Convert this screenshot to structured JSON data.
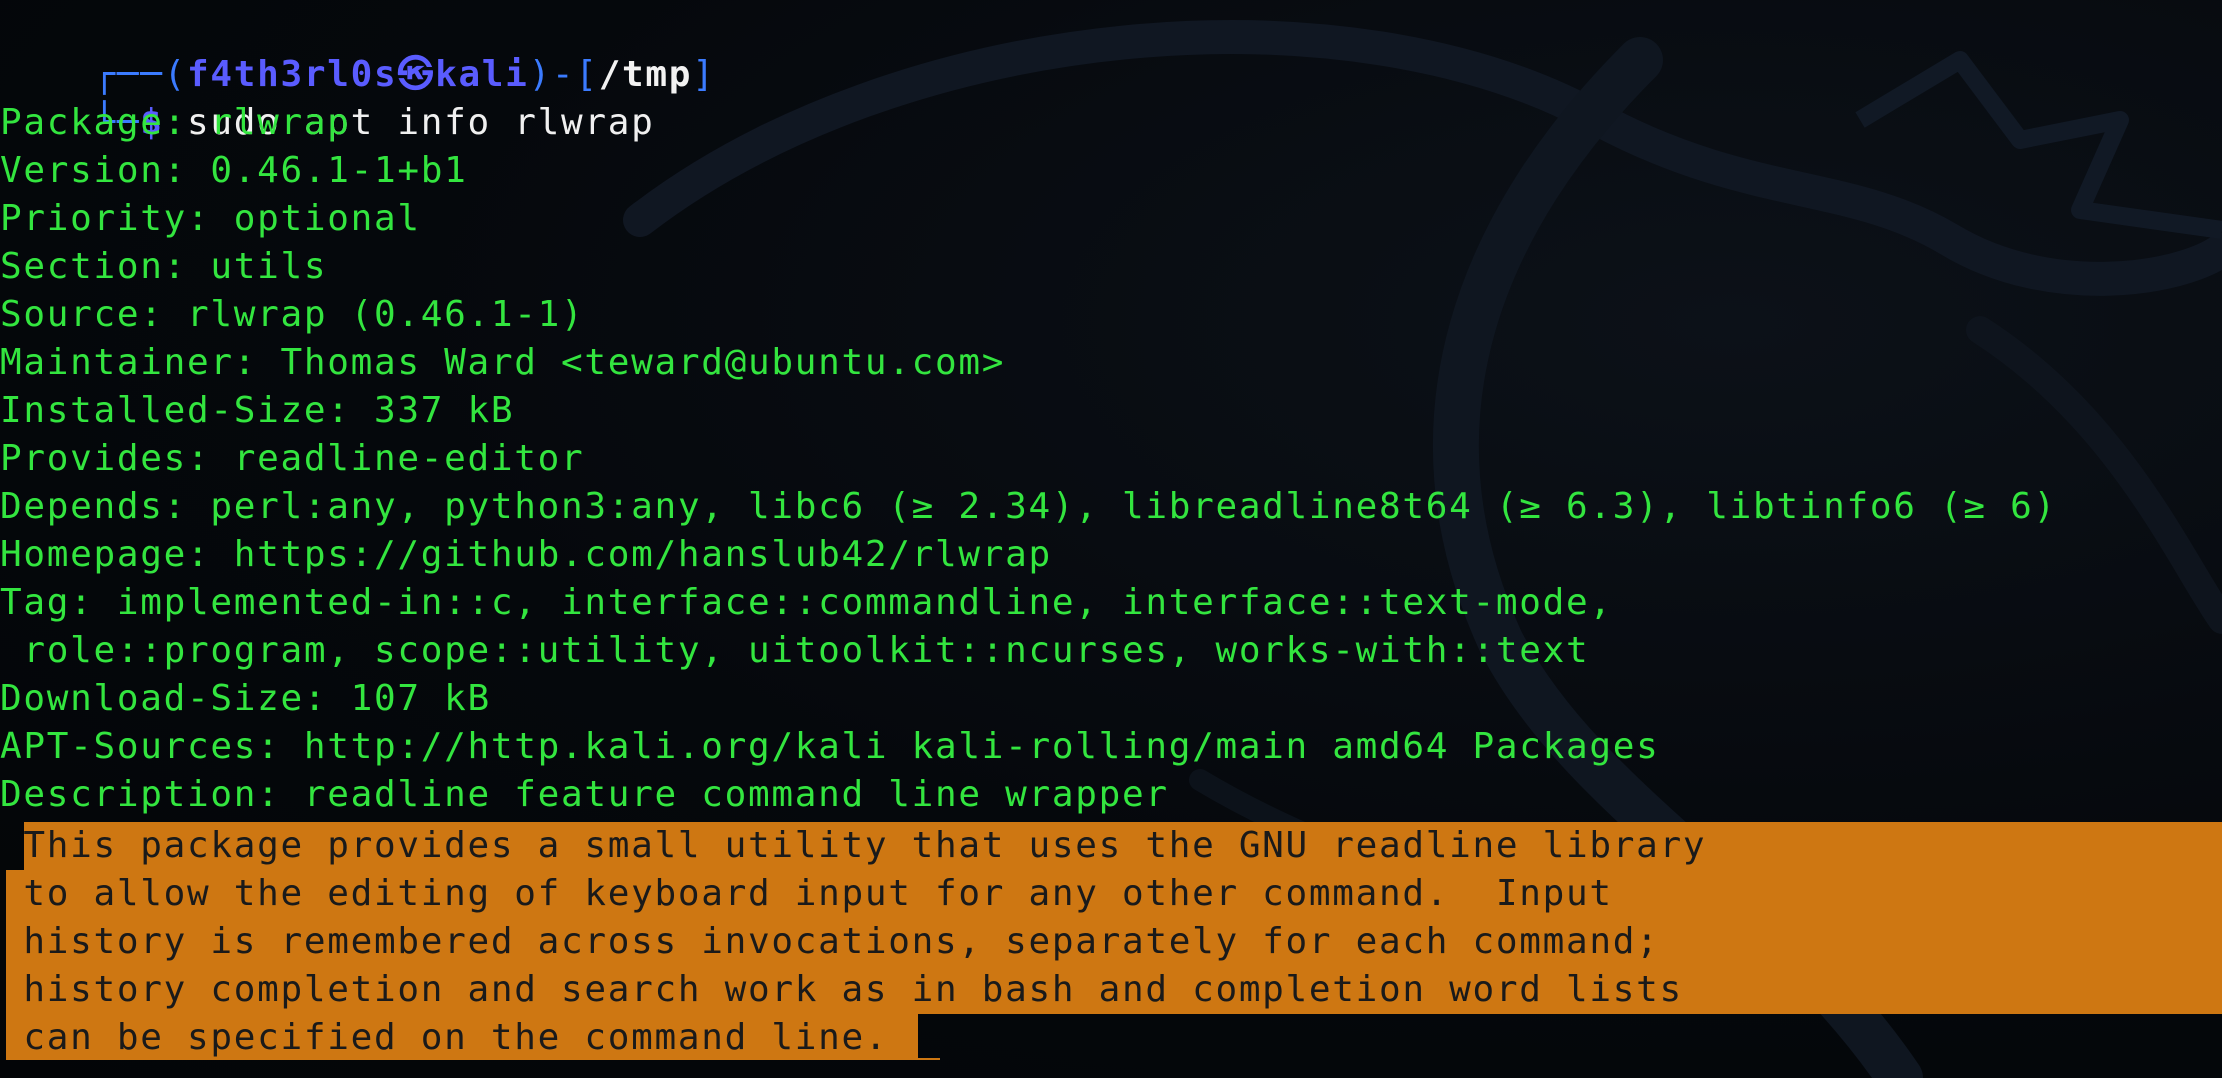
{
  "prompt": {
    "user_host": "f4th3rl0s㉿kali",
    "cwd": "/tmp",
    "command": "sudo apt info rlwrap"
  },
  "output": {
    "package": "Package: rlwrap",
    "version": "Version: 0.46.1-1+b1",
    "priority": "Priority: optional",
    "section": "Section: utils",
    "source": "Source: rlwrap (0.46.1-1)",
    "maintainer": "Maintainer: Thomas Ward <teward@ubuntu.com>",
    "installed_size": "Installed-Size: 337 kB",
    "provides": "Provides: readline-editor",
    "depends": "Depends: perl:any, python3:any, libc6 (≥ 2.34), libreadline8t64 (≥ 6.3), libtinfo6 (≥ 6)",
    "homepage": "Homepage: https://github.com/hanslub42/rlwrap",
    "tag_1": "Tag: implemented-in::c, interface::commandline, interface::text-mode,",
    "tag_2": " role::program, scope::utility, uitoolkit::ncurses, works-with::text",
    "download_size": "Download-Size: 107 kB",
    "apt_sources": "APT-Sources: http://http.kali.org/kali kali-rolling/main amd64 Packages",
    "description": "Description: readline feature command line wrapper"
  },
  "selected_description": [
    " This package provides a small utility that uses the GNU readline library",
    " to allow the editing of keyboard input for any other command.  Input",
    " history is remembered across invocations, separately for each command;",
    " history completion and search work as in bash and completion word lists",
    " can be specified on the command line."
  ],
  "colors": {
    "output_green": "#33e53f",
    "prompt_blue": "#3b7bff",
    "selection_orange": "#ce7712"
  }
}
